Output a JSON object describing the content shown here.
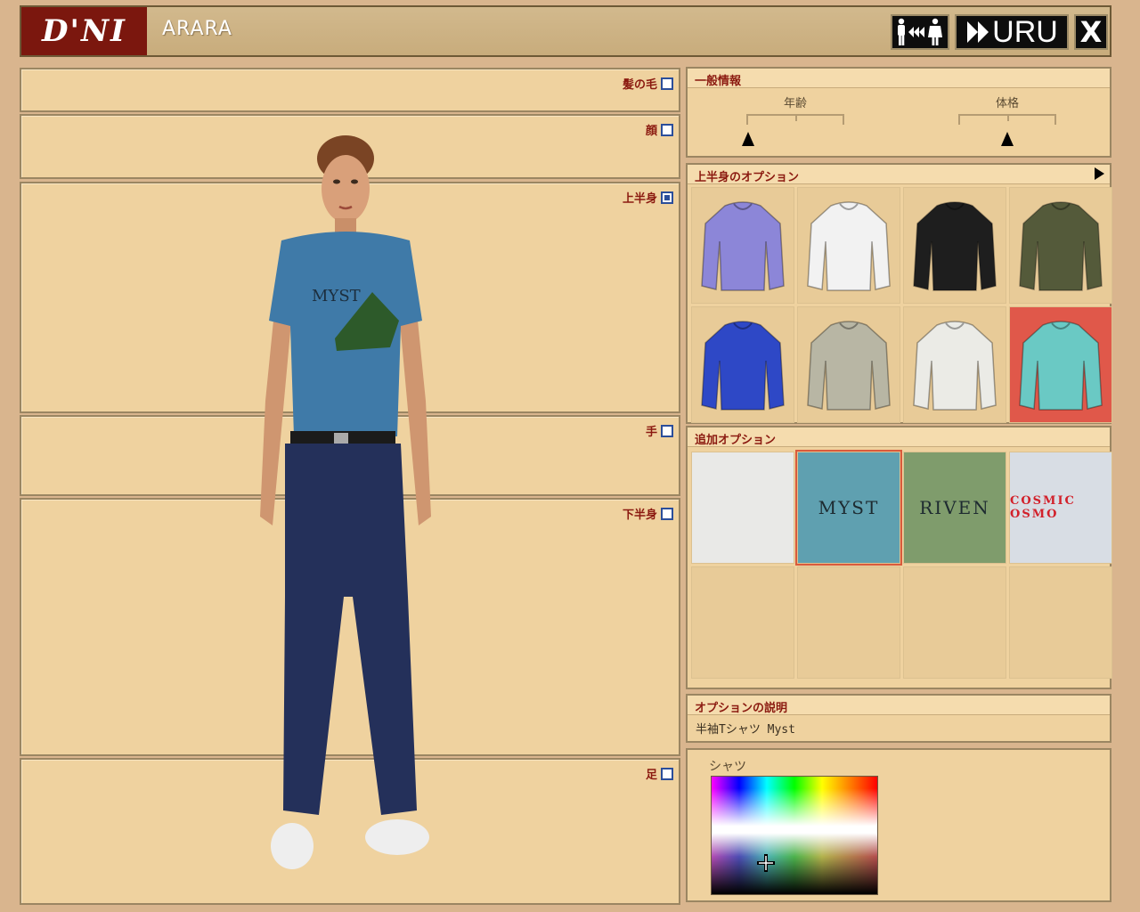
{
  "header": {
    "logo_text": "D'NI",
    "player_name": "ARARA",
    "uru_label": "URU",
    "close_label": "X"
  },
  "left_panels": {
    "hair": {
      "label": "髪の毛",
      "checked": false
    },
    "face": {
      "label": "顔",
      "checked": false
    },
    "torso": {
      "label": "上半身",
      "checked": true
    },
    "hands": {
      "label": "手",
      "checked": false
    },
    "legs": {
      "label": "下半身",
      "checked": false
    },
    "feet": {
      "label": "足",
      "checked": false
    }
  },
  "avatar": {
    "shirt_text": "MYST"
  },
  "general_info": {
    "title": "一般情報",
    "age_label": "年齢",
    "age_value": 0.0,
    "build_label": "体格",
    "build_value": 0.5
  },
  "upper_options": {
    "title": "上半身のオプション",
    "items": [
      {
        "name": "purple-jacket",
        "color": "#8c86d8"
      },
      {
        "name": "white-tank",
        "color": "#f2f2f2"
      },
      {
        "name": "black-leather-jacket",
        "color": "#1e1e1e"
      },
      {
        "name": "olive-hoodie",
        "color": "#545a3a"
      },
      {
        "name": "blue-hoodie",
        "color": "#2e48c6"
      },
      {
        "name": "grey-sweater",
        "color": "#b8b6a4"
      },
      {
        "name": "white-longsleeve",
        "color": "#ebebe6"
      },
      {
        "name": "teal-tshirt",
        "color": "#6ac9c4"
      }
    ],
    "selected_index": 7
  },
  "extra_options": {
    "title": "追加オプション",
    "decals": [
      {
        "name": "blank",
        "text": ""
      },
      {
        "name": "myst",
        "text": "MYST"
      },
      {
        "name": "riven",
        "text": "RIVEN"
      },
      {
        "name": "cosmic-osmo",
        "text": "COSMIC OSMO"
      }
    ],
    "selected_index": 1
  },
  "option_description": {
    "title": "オプションの説明",
    "text": "半袖Tシャツ Myst"
  },
  "color": {
    "label": "シャツ",
    "selected_color": "#5b7fa8"
  },
  "colors": {
    "accent": "#8b1a10",
    "panel": "#efd29f",
    "background": "#d9b58e",
    "selected_cell": "#e0584a"
  }
}
